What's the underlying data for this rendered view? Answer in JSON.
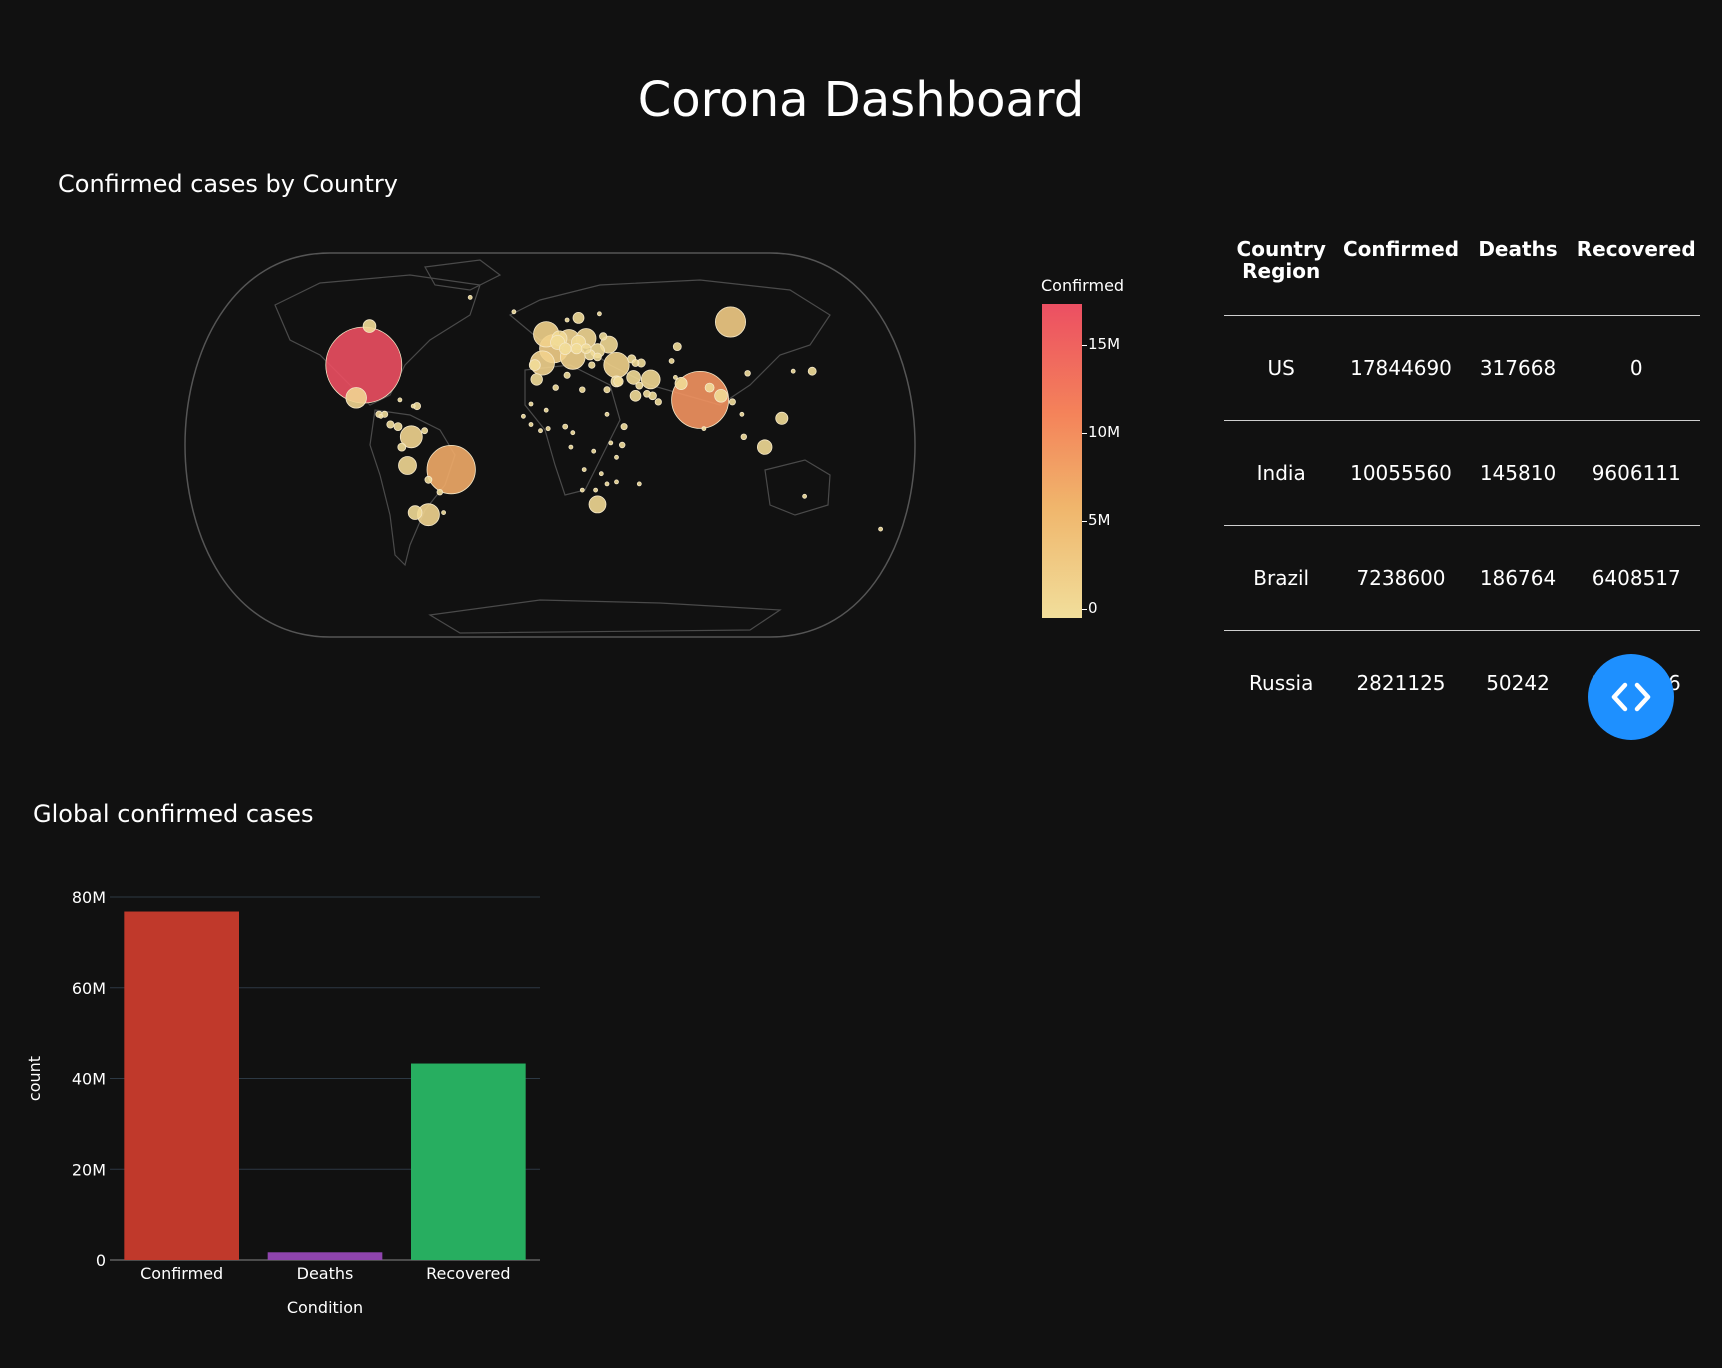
{
  "page": {
    "title": "Corona Dashboard"
  },
  "map": {
    "title": "Confirmed cases by Country",
    "colorbar": {
      "title": "Confirmed",
      "ticks": [
        "15M",
        "10M",
        "5M",
        "0"
      ],
      "tick_values": [
        15000000,
        10000000,
        5000000,
        0
      ],
      "max": 17844690,
      "colors": [
        "#f1de9b",
        "#f0b66c",
        "#f4835a",
        "#ec4f62"
      ]
    },
    "bubbles": [
      {
        "region": "US",
        "lon": -98,
        "lat": 39,
        "confirmed": 17844690
      },
      {
        "region": "India",
        "lon": 79,
        "lat": 22,
        "confirmed": 10055560
      },
      {
        "region": "Brazil",
        "lon": -52,
        "lat": -12,
        "confirmed": 7238600
      },
      {
        "region": "Russia",
        "lon": 95,
        "lat": 60,
        "confirmed": 2821125
      },
      {
        "region": "France",
        "lon": 2,
        "lat": 47,
        "confirmed": 2500000
      },
      {
        "region": "UK",
        "lon": -2,
        "lat": 54,
        "confirmed": 2000000
      },
      {
        "region": "Turkey",
        "lon": 35,
        "lat": 39,
        "confirmed": 2000000
      },
      {
        "region": "Italy",
        "lon": 12,
        "lat": 43,
        "confirmed": 1900000
      },
      {
        "region": "Spain",
        "lon": -4,
        "lat": 40,
        "confirmed": 1800000
      },
      {
        "region": "Argentina",
        "lon": -64,
        "lat": -34,
        "confirmed": 1500000
      },
      {
        "region": "Colombia",
        "lon": -73,
        "lat": 4,
        "confirmed": 1500000
      },
      {
        "region": "Germany",
        "lon": 10,
        "lat": 51,
        "confirmed": 1500000
      },
      {
        "region": "Mexico",
        "lon": -102,
        "lat": 23,
        "confirmed": 1300000
      },
      {
        "region": "Poland",
        "lon": 19,
        "lat": 52,
        "confirmed": 1200000
      },
      {
        "region": "Iran",
        "lon": 53,
        "lat": 32,
        "confirmed": 1100000
      },
      {
        "region": "Peru",
        "lon": -75,
        "lat": -10,
        "confirmed": 1000000
      },
      {
        "region": "Ukraine",
        "lon": 31,
        "lat": 49,
        "confirmed": 900000
      },
      {
        "region": "South Africa",
        "lon": 25,
        "lat": -29,
        "confirmed": 900000
      },
      {
        "region": "Indonesia",
        "lon": 113,
        "lat": -1,
        "confirmed": 650000
      },
      {
        "region": "Netherlands",
        "lon": 5,
        "lat": 52,
        "confirmed": 700000
      },
      {
        "region": "Chile",
        "lon": -71,
        "lat": -33,
        "confirmed": 580000
      },
      {
        "region": "Canada",
        "lon": -95,
        "lat": 58,
        "confirmed": 500000
      },
      {
        "region": "Iraq",
        "lon": 44,
        "lat": 33,
        "confirmed": 580000
      },
      {
        "region": "Philippines",
        "lon": 122,
        "lat": 13,
        "confirmed": 460000
      },
      {
        "region": "Bangladesh",
        "lon": 90,
        "lat": 24,
        "confirmed": 500000
      },
      {
        "region": "Pakistan",
        "lon": 69,
        "lat": 30,
        "confirmed": 460000
      },
      {
        "region": "Saudi Arabia",
        "lon": 45,
        "lat": 24,
        "confirmed": 360000
      },
      {
        "region": "Belgium",
        "lon": 4,
        "lat": 50,
        "confirmed": 630000
      },
      {
        "region": "Romania",
        "lon": 25,
        "lat": 46,
        "confirmed": 600000
      },
      {
        "region": "Czechia",
        "lon": 15,
        "lat": 50,
        "confirmed": 630000
      },
      {
        "region": "Israel",
        "lon": 35,
        "lat": 31,
        "confirmed": 380000
      },
      {
        "region": "Sweden",
        "lon": 15,
        "lat": 62,
        "confirmed": 380000
      },
      {
        "region": "Morocco",
        "lon": -7,
        "lat": 32,
        "confirmed": 410000
      },
      {
        "region": "Portugal",
        "lon": -8,
        "lat": 39,
        "confirmed": 370000
      },
      {
        "region": "Switzerland",
        "lon": 8,
        "lat": 47,
        "confirmed": 420000
      },
      {
        "region": "Hungary",
        "lon": 19,
        "lat": 47,
        "confirmed": 300000
      },
      {
        "region": "Austria",
        "lon": 14,
        "lat": 47,
        "confirmed": 340000
      },
      {
        "region": "Serbia",
        "lon": 21,
        "lat": 44,
        "confirmed": 320000
      },
      {
        "region": "Japan",
        "lon": 138,
        "lat": 36,
        "confirmed": 200000
      },
      {
        "region": "Jordan",
        "lon": 36,
        "lat": 31,
        "confirmed": 280000
      },
      {
        "region": "Nepal",
        "lon": 84,
        "lat": 28,
        "confirmed": 250000
      },
      {
        "region": "Kazakhstan",
        "lon": 67,
        "lat": 48,
        "confirmed": 200000
      },
      {
        "region": "Ecuador",
        "lon": -78,
        "lat": -1,
        "confirmed": 200000
      },
      {
        "region": "Panama",
        "lon": -80,
        "lat": 9,
        "confirmed": 200000
      },
      {
        "region": "Bolivia",
        "lon": -64,
        "lat": -17,
        "confirmed": 150000
      },
      {
        "region": "Dominican Rep.",
        "lon": -70,
        "lat": 19,
        "confirmed": 160000
      },
      {
        "region": "Guatemala",
        "lon": -90,
        "lat": 15,
        "confirmed": 130000
      },
      {
        "region": "Costa Rica",
        "lon": -84,
        "lat": 10,
        "confirmed": 160000
      },
      {
        "region": "UAE",
        "lon": 54,
        "lat": 24,
        "confirmed": 190000
      },
      {
        "region": "Kuwait",
        "lon": 47,
        "lat": 29,
        "confirmed": 150000
      },
      {
        "region": "Egypt",
        "lon": 30,
        "lat": 27,
        "confirmed": 120000
      },
      {
        "region": "Ethiopia",
        "lon": 39,
        "lat": 9,
        "confirmed": 120000
      },
      {
        "region": "Kenya",
        "lon": 38,
        "lat": 0,
        "confirmed": 95000
      },
      {
        "region": "Nigeria",
        "lon": 8,
        "lat": 9,
        "confirmed": 80000
      },
      {
        "region": "Algeria",
        "lon": 3,
        "lat": 28,
        "confirmed": 95000
      },
      {
        "region": "Malaysia",
        "lon": 102,
        "lat": 4,
        "confirmed": 95000
      },
      {
        "region": "Korea",
        "lon": 128,
        "lat": 36,
        "confirmed": 50000
      },
      {
        "region": "China",
        "lon": 104,
        "lat": 35,
        "confirmed": 95000
      },
      {
        "region": "Honduras",
        "lon": -87,
        "lat": 15,
        "confirmed": 115000
      },
      {
        "region": "Venezuela",
        "lon": -66,
        "lat": 7,
        "confirmed": 110000
      },
      {
        "region": "Paraguay",
        "lon": -58,
        "lat": -23,
        "confirmed": 100000
      },
      {
        "region": "Ghana",
        "lon": -1,
        "lat": 8,
        "confirmed": 53000
      },
      {
        "region": "Cameroon",
        "lon": 12,
        "lat": 6,
        "confirmed": 26000
      },
      {
        "region": "Zambia",
        "lon": 27,
        "lat": -14,
        "confirmed": 19000
      },
      {
        "region": "Madagascar",
        "lon": 47,
        "lat": -19,
        "confirmed": 17000
      },
      {
        "region": "Mozambique",
        "lon": 35,
        "lat": -18,
        "confirmed": 18000
      },
      {
        "region": "Senegal",
        "lon": -14,
        "lat": 14,
        "confirmed": 17000
      },
      {
        "region": "Ivory Coast",
        "lon": -5,
        "lat": 7,
        "confirmed": 22000
      },
      {
        "region": "Sudan",
        "lon": 30,
        "lat": 15,
        "confirmed": 22000
      },
      {
        "region": "Libya",
        "lon": 17,
        "lat": 27,
        "confirmed": 95000
      },
      {
        "region": "Tunisia",
        "lon": 9,
        "lat": 34,
        "confirmed": 120000
      },
      {
        "region": "Uganda",
        "lon": 32,
        "lat": 1,
        "confirmed": 30000
      },
      {
        "region": "Angola",
        "lon": 18,
        "lat": -12,
        "confirmed": 17000
      },
      {
        "region": "Namibia",
        "lon": 17,
        "lat": -22,
        "confirmed": 20000
      },
      {
        "region": "Botswana",
        "lon": 24,
        "lat": -22,
        "confirmed": 13000
      },
      {
        "region": "Mali",
        "lon": -2,
        "lat": 17,
        "confirmed": 6000
      },
      {
        "region": "Mauritania",
        "lon": -10,
        "lat": 20,
        "confirmed": 10000
      },
      {
        "region": "Guinea",
        "lon": -10,
        "lat": 10,
        "confirmed": 13000
      },
      {
        "region": "Gabon",
        "lon": 11,
        "lat": -1,
        "confirmed": 9000
      },
      {
        "region": "DR Congo",
        "lon": 23,
        "lat": -3,
        "confirmed": 15000
      },
      {
        "region": "Tanzania",
        "lon": 35,
        "lat": -6,
        "confirmed": 500
      },
      {
        "region": "Zimbabwe",
        "lon": 30,
        "lat": -19,
        "confirmed": 12000
      },
      {
        "region": "Australia",
        "lon": 134,
        "lat": -25,
        "confirmed": 28000
      },
      {
        "region": "New Zealand",
        "lon": 174,
        "lat": -41,
        "confirmed": 2100
      },
      {
        "region": "Thailand",
        "lon": 101,
        "lat": 15,
        "confirmed": 5000
      },
      {
        "region": "Sri Lanka",
        "lon": 81,
        "lat": 8,
        "confirmed": 37000
      },
      {
        "region": "Myanmar",
        "lon": 96,
        "lat": 21,
        "confirmed": 115000
      },
      {
        "region": "Greenland",
        "lon": -42,
        "lat": 72,
        "confirmed": 30
      },
      {
        "region": "Iceland",
        "lon": -19,
        "lat": 65,
        "confirmed": 5600
      },
      {
        "region": "Norway",
        "lon": 9,
        "lat": 61,
        "confirmed": 45000
      },
      {
        "region": "Finland",
        "lon": 26,
        "lat": 64,
        "confirmed": 33000
      },
      {
        "region": "Uzbekistan",
        "lon": 64,
        "lat": 41,
        "confirmed": 76000
      },
      {
        "region": "Afghanistan",
        "lon": 66,
        "lat": 33,
        "confirmed": 50000
      },
      {
        "region": "Oman",
        "lon": 57,
        "lat": 21,
        "confirmed": 127000
      },
      {
        "region": "Qatar",
        "lon": 51,
        "lat": 25,
        "confirmed": 141000
      },
      {
        "region": "Georgia",
        "lon": 43,
        "lat": 42,
        "confirmed": 210000
      },
      {
        "region": "Armenia",
        "lon": 45,
        "lat": 40,
        "confirmed": 150000
      },
      {
        "region": "Azerbaijan",
        "lon": 48,
        "lat": 40,
        "confirmed": 210000
      },
      {
        "region": "Belarus",
        "lon": 28,
        "lat": 53,
        "confirmed": 170000
      },
      {
        "region": "Greece",
        "lon": 22,
        "lat": 39,
        "confirmed": 130000
      },
      {
        "region": "Bulgaria",
        "lon": 25,
        "lat": 43,
        "confirmed": 190000
      },
      {
        "region": "Cuba",
        "lon": -79,
        "lat": 22,
        "confirmed": 10000
      },
      {
        "region": "Haiti",
        "lon": -72,
        "lat": 19,
        "confirmed": 9000
      },
      {
        "region": "El Salvador",
        "lon": -89,
        "lat": 14,
        "confirmed": 43000
      },
      {
        "region": "Uruguay",
        "lon": -56,
        "lat": -33,
        "confirmed": 13000
      }
    ]
  },
  "table": {
    "columns": [
      "Country\nRegion",
      "Confirmed",
      "Deaths",
      "Recovered"
    ],
    "rows": [
      [
        "US",
        "17844690",
        "317668",
        "0"
      ],
      [
        "India",
        "10055560",
        "145810",
        "9606111"
      ],
      [
        "Brazil",
        "7238600",
        "186764",
        "6408517"
      ],
      [
        "Russia",
        "2821125",
        "50242",
        "2256896"
      ]
    ]
  },
  "nav_toggle": {
    "icon": "code-brackets-icon",
    "color": "#1e90ff"
  },
  "bar": {
    "title": "Global confirmed cases"
  },
  "chart_data": {
    "type": "bar",
    "title": "Global confirmed cases",
    "categories": [
      "Confirmed",
      "Deaths",
      "Recovered"
    ],
    "values": [
      76800000,
      1700000,
      43300000
    ],
    "colors": [
      "#c0392b",
      "#8e44ad",
      "#27ae60"
    ],
    "xlabel": "Condition",
    "ylabel": "count",
    "ylim": [
      0,
      80000000
    ],
    "yticks": [
      0,
      20000000,
      40000000,
      60000000,
      80000000
    ],
    "ytick_labels": [
      "0",
      "20M",
      "40M",
      "60M",
      "80M"
    ],
    "grid": true
  }
}
